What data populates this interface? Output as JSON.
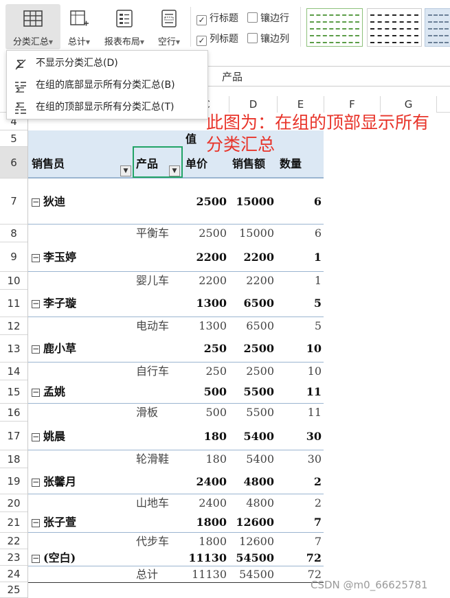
{
  "ribbon": {
    "buttons": [
      {
        "label": "分类汇总",
        "icon": "subtotal-grid-icon"
      },
      {
        "label": "总计",
        "icon": "grand-total-icon"
      },
      {
        "label": "报表布局",
        "icon": "report-layout-icon"
      },
      {
        "label": "空行",
        "icon": "blank-row-icon"
      }
    ],
    "checkboxes": [
      {
        "label": "行标题",
        "checked": true
      },
      {
        "label": "镶边行",
        "checked": false
      },
      {
        "label": "列标题",
        "checked": true
      },
      {
        "label": "镶边列",
        "checked": false
      }
    ],
    "check_mark": "✓"
  },
  "menu": {
    "items": [
      {
        "label": "不显示分类汇总(D)",
        "icon": "no-subtotal-icon"
      },
      {
        "label": "在组的底部显示所有分类汇总(B)",
        "icon": "subtotal-bottom-icon"
      },
      {
        "label": "在组的顶部显示所有分类汇总(T)",
        "icon": "subtotal-top-icon"
      }
    ]
  },
  "formula_bar": {
    "value": "产品"
  },
  "columns": [
    "C",
    "D",
    "E",
    "F",
    "G"
  ],
  "row_numbers": [
    "4",
    "5",
    "6",
    "7",
    "8",
    "9",
    "10",
    "11",
    "12",
    "13",
    "14",
    "15",
    "16",
    "17",
    "18",
    "19",
    "20",
    "21",
    "22",
    "23",
    "24",
    "25"
  ],
  "pivot": {
    "values_caption": "值",
    "headers": {
      "salesperson": "销售员",
      "product": "产品",
      "price": "单价",
      "sales": "销售额",
      "qty": "数量"
    },
    "rows": [
      {
        "kind": "group",
        "name": "狄迪",
        "price": "2500",
        "sales": "15000",
        "qty": "6"
      },
      {
        "kind": "item",
        "product": "平衡车",
        "price": "2500",
        "sales": "15000",
        "qty": "6"
      },
      {
        "kind": "group",
        "name": "李玉婷",
        "price": "2200",
        "sales": "2200",
        "qty": "1"
      },
      {
        "kind": "item",
        "product": "婴儿车",
        "price": "2200",
        "sales": "2200",
        "qty": "1"
      },
      {
        "kind": "group",
        "name": "李子璇",
        "price": "1300",
        "sales": "6500",
        "qty": "5"
      },
      {
        "kind": "item",
        "product": "电动车",
        "price": "1300",
        "sales": "6500",
        "qty": "5"
      },
      {
        "kind": "group",
        "name": "鹿小草",
        "price": "250",
        "sales": "2500",
        "qty": "10"
      },
      {
        "kind": "item",
        "product": "自行车",
        "price": "250",
        "sales": "2500",
        "qty": "10"
      },
      {
        "kind": "group",
        "name": "孟姚",
        "price": "500",
        "sales": "5500",
        "qty": "11"
      },
      {
        "kind": "item",
        "product": "滑板",
        "price": "500",
        "sales": "5500",
        "qty": "11"
      },
      {
        "kind": "group",
        "name": "姚晨",
        "price": "180",
        "sales": "5400",
        "qty": "30"
      },
      {
        "kind": "item",
        "product": "轮滑鞋",
        "price": "180",
        "sales": "5400",
        "qty": "30"
      },
      {
        "kind": "group",
        "name": "张馨月",
        "price": "2400",
        "sales": "4800",
        "qty": "2"
      },
      {
        "kind": "item",
        "product": "山地车",
        "price": "2400",
        "sales": "4800",
        "qty": "2"
      },
      {
        "kind": "group",
        "name": "张子萱",
        "price": "1800",
        "sales": "12600",
        "qty": "7"
      },
      {
        "kind": "item",
        "product": "代步车",
        "price": "1800",
        "sales": "12600",
        "qty": "7"
      },
      {
        "kind": "group",
        "name": "(空白)",
        "price": "11130",
        "sales": "54500",
        "qty": "72"
      },
      {
        "kind": "item",
        "product": "总计",
        "price": "11130",
        "sales": "54500",
        "qty": "72"
      }
    ]
  },
  "annotation": "此图为：在组的顶部显示所有分类汇总",
  "watermark": "CSDN @m0_66625781",
  "colors": {
    "band": "#dce8f4",
    "accent_annotation": "#e8342a",
    "selected_cell_border": "#21a366"
  }
}
